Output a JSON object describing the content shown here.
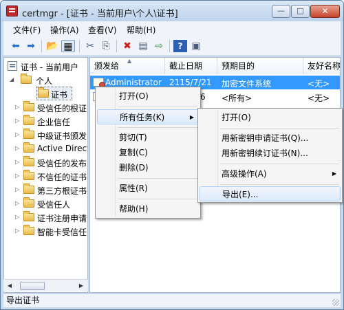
{
  "window": {
    "title": "certmgr - [证书 - 当前用户\\个人\\证书]",
    "minimize_label": "—",
    "maximize_label": "□",
    "close_label": "✕"
  },
  "menubar": {
    "items": [
      "文件(F)",
      "操作(A)",
      "查看(V)",
      "帮助(H)"
    ]
  },
  "toolbar": {
    "back_glyph": "⬅",
    "forward_glyph": "➡",
    "up_glyph": "📂",
    "view_glyph": "▦",
    "cut_glyph": "✂",
    "copy_glyph": "⎘",
    "delete_glyph": "✖",
    "properties_glyph": "▤",
    "export_glyph": "⇨",
    "help_glyph": "?",
    "console_glyph": "▣"
  },
  "tree": {
    "root": "证书 - 当前用户",
    "items": [
      "个人",
      "证书",
      "受信任的根证",
      "企业信任",
      "中级证书颁发",
      "Active Direct",
      "受信任的发布",
      "不信任的证书",
      "第三方根证书",
      "受信任人",
      "证书注册申请",
      "智能卡受信任"
    ],
    "expander_collapsed": "▷",
    "expander_expanded": "◢"
  },
  "list": {
    "columns": [
      "颁发给",
      "截止日期",
      "预期目的",
      "友好名称"
    ],
    "sort_arrow": "▲",
    "rows": [
      {
        "issued_to": "Administrator",
        "expiry": "2115/7/21",
        "purpose": "加密文件系统",
        "friendly": "<无>"
      },
      {
        "issued_to": "",
        "expiry": "6",
        "purpose": "<所有>",
        "friendly": "<无>"
      }
    ]
  },
  "context_menu": {
    "items": [
      "打开(O)",
      "所有任务(K)",
      "剪切(T)",
      "复制(C)",
      "删除(D)",
      "属性(R)",
      "帮助(H)"
    ],
    "submenu_arrow": "▶"
  },
  "submenu": {
    "items": [
      "打开(O)",
      "用新密钥申请证书(Q)...",
      "用新密钥续订证书(N)...",
      "高级操作(A)",
      "导出(E)..."
    ]
  },
  "hscroll": {
    "left": "◀",
    "right": "▶"
  },
  "status": {
    "text": "导出证书"
  },
  "colors": {
    "selection": "#3399ff",
    "window_chrome": "#c8daee",
    "close_button": "#c7432a"
  }
}
